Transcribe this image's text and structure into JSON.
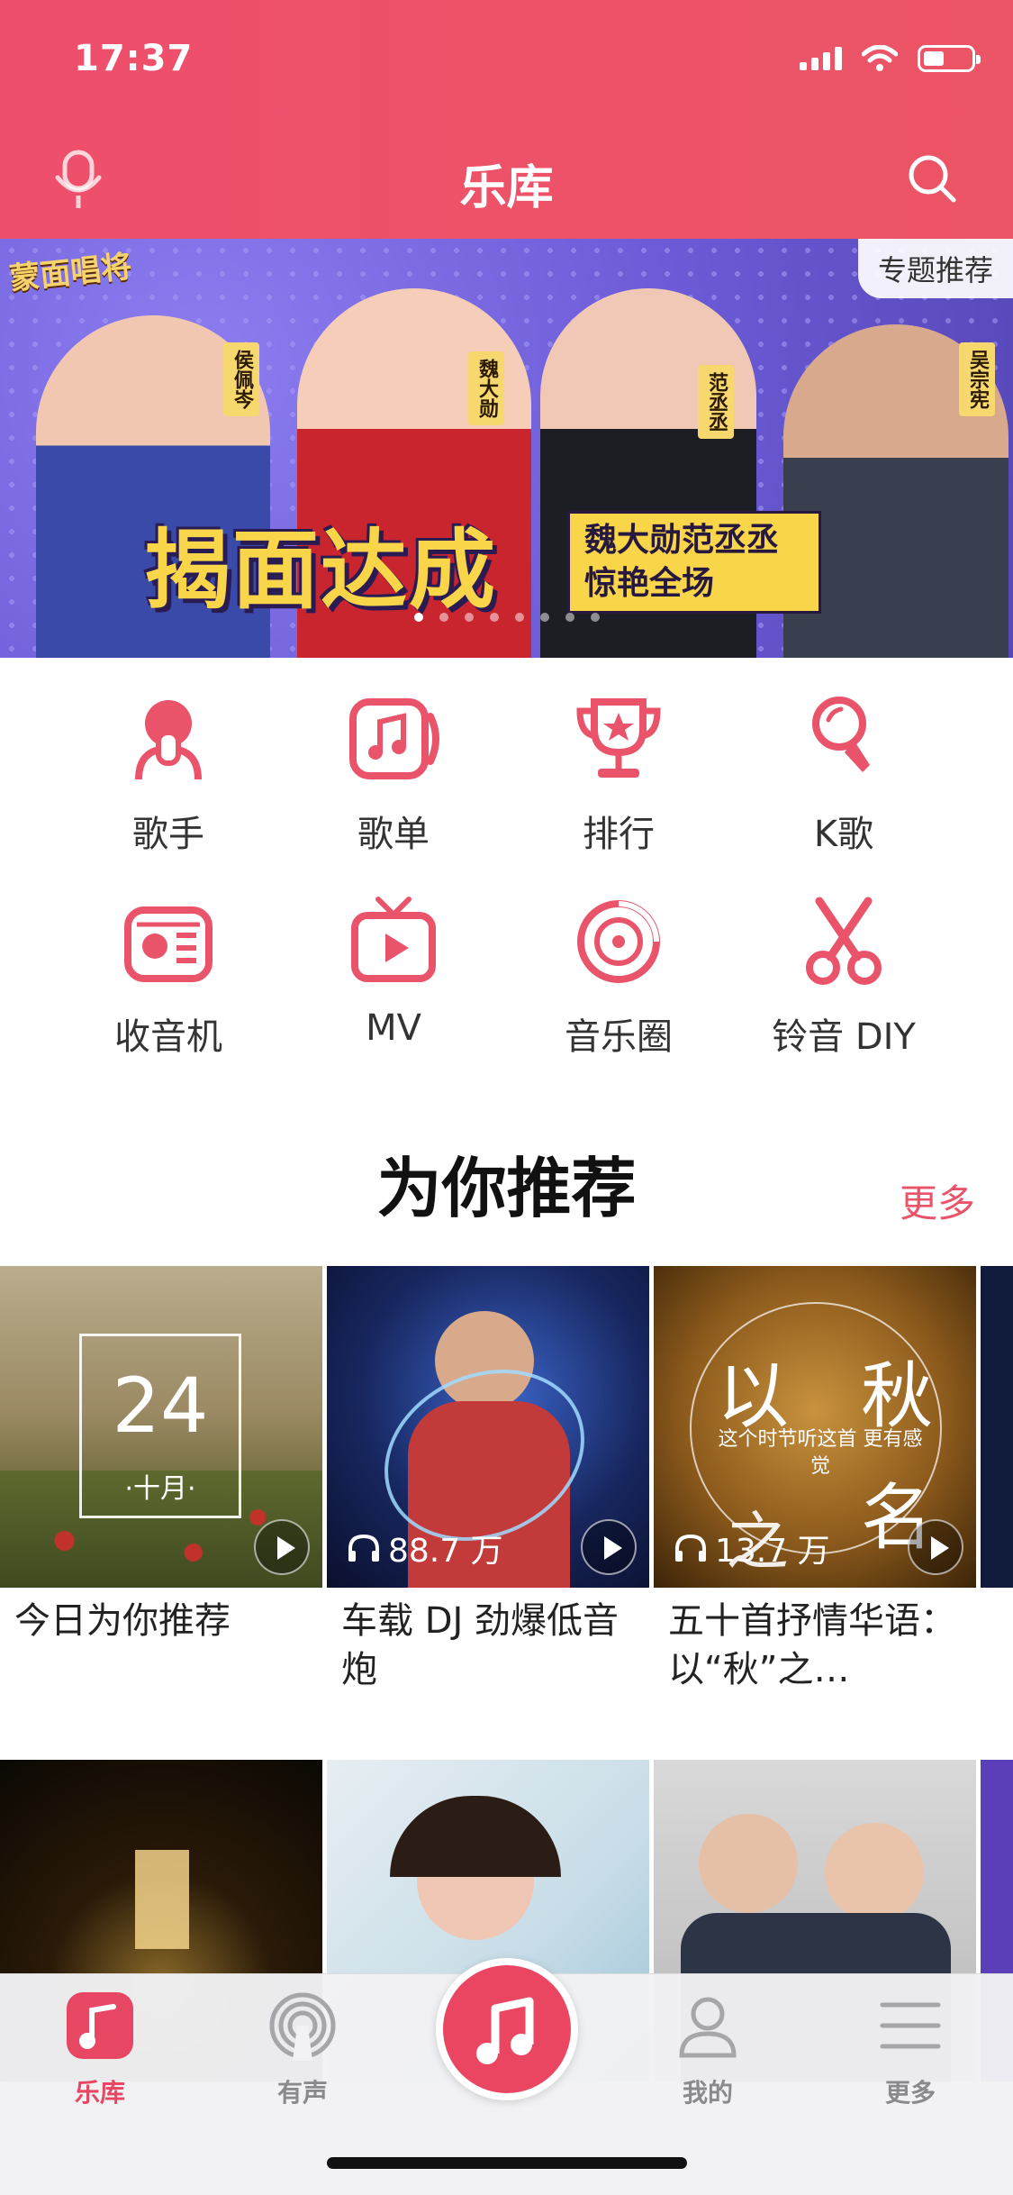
{
  "status_bar": {
    "time": "17:37"
  },
  "header": {
    "title": "乐库"
  },
  "banner": {
    "show_logo": "蒙面唱将",
    "headline": "揭面达成",
    "subline": "魏大勋范丞丞 惊艳全场",
    "names": [
      "侯佩岑",
      "魏大勋",
      "范丞丞",
      "吴宗宪"
    ],
    "topic_tag": "专题推荐"
  },
  "categories": [
    {
      "label": "歌手",
      "icon": "singer-icon"
    },
    {
      "label": "歌单",
      "icon": "playlist-icon"
    },
    {
      "label": "排行",
      "icon": "trophy-icon"
    },
    {
      "label": "K歌",
      "icon": "karaoke-mic-icon"
    },
    {
      "label": "收音机",
      "icon": "radio-icon"
    },
    {
      "label": "MV",
      "icon": "tv-icon"
    },
    {
      "label": "音乐圈",
      "icon": "music-circle-icon"
    },
    {
      "label": "铃音 DIY",
      "icon": "scissors-icon"
    }
  ],
  "recommend": {
    "title": "为你推荐",
    "more": "更多",
    "cards": [
      {
        "caption": "今日为你推荐",
        "date_day": "24",
        "date_month": "·十月·"
      },
      {
        "caption": "车载 DJ 劲爆低音炮",
        "listens": "88.7 万"
      },
      {
        "caption": "五十首抒情华语：以“秋”之…",
        "listens": "13.7 万",
        "cover_text": {
          "big1": "以",
          "big2": "秋",
          "big3": "名",
          "big4": "之",
          "small": "这个时节听这首 更有感觉"
        }
      }
    ]
  },
  "tabbar": {
    "tabs": [
      {
        "label": "乐库",
        "icon": "music-note-icon",
        "active": true
      },
      {
        "label": "有声",
        "icon": "broadcast-icon",
        "active": false
      },
      {
        "label": "我的",
        "icon": "user-icon",
        "active": false
      },
      {
        "label": "更多",
        "icon": "menu-icon",
        "active": false
      }
    ]
  },
  "colors": {
    "accent": "#E9546B",
    "header": "#EE4F6C",
    "banner_headline": "#F9D54A"
  }
}
